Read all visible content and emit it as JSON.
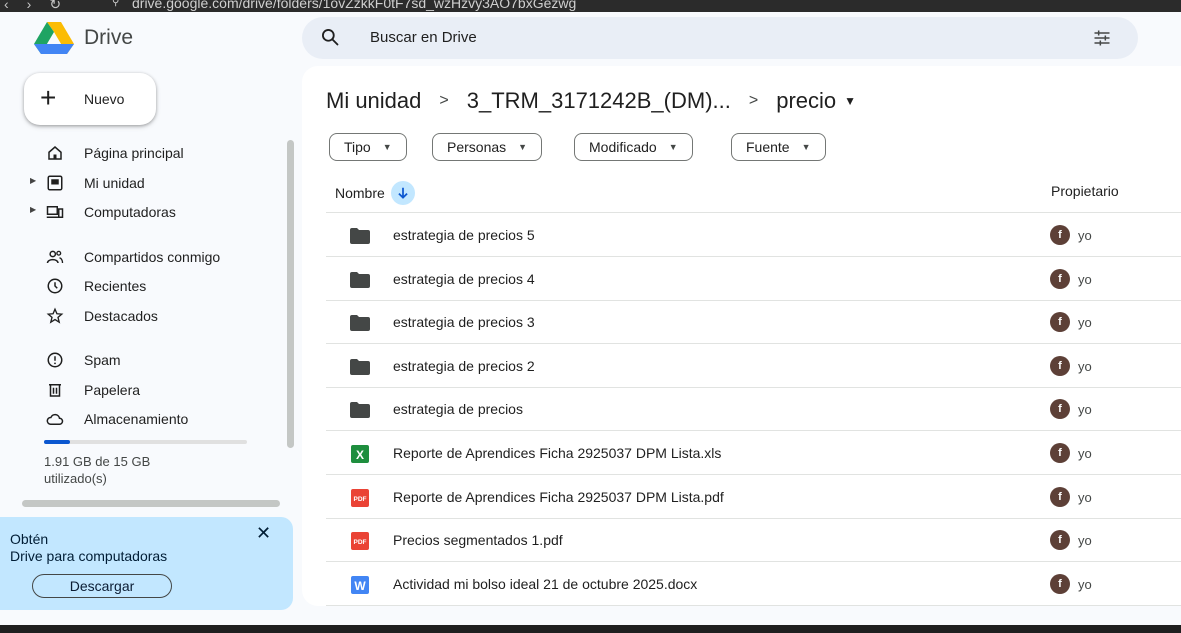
{
  "browser": {
    "url": "drive.google.com/drive/folders/1ovZzkkF0tF7sd_wzHzvy3AO7bxGezwg"
  },
  "header": {
    "brand": "Drive",
    "search_placeholder": "Buscar en Drive"
  },
  "sidebar": {
    "new_label": "Nuevo",
    "items": [
      {
        "label": "Página principal",
        "icon": "home-icon",
        "caret": false
      },
      {
        "label": "Mi unidad",
        "icon": "my-drive-icon",
        "caret": true
      },
      {
        "label": "Computadoras",
        "icon": "computers-icon",
        "caret": true
      },
      {
        "label": "Compartidos conmigo",
        "icon": "shared-icon",
        "caret": false
      },
      {
        "label": "Recientes",
        "icon": "clock-icon",
        "caret": false
      },
      {
        "label": "Destacados",
        "icon": "star-icon",
        "caret": false
      },
      {
        "label": "Spam",
        "icon": "spam-icon",
        "caret": false
      },
      {
        "label": "Papelera",
        "icon": "trash-icon",
        "caret": false
      },
      {
        "label": "Almacenamiento",
        "icon": "cloud-icon",
        "caret": false
      }
    ],
    "storage": {
      "text_line1": "1.91 GB de 15 GB",
      "text_line2": "utilizado(s)",
      "used_fraction": 0.127
    },
    "promo": {
      "line1": "Obtén",
      "line2": "Drive para computadoras",
      "button": "Descargar"
    }
  },
  "main": {
    "breadcrumb": [
      "Mi unidad",
      "3_TRM_3171242B_(DM)...",
      "precio"
    ],
    "filters": [
      "Tipo",
      "Personas",
      "Modificado",
      "Fuente"
    ],
    "columns": {
      "name": "Nombre",
      "owner": "Propietario"
    },
    "files": [
      {
        "name": "estrategia de precios 5",
        "type": "folder",
        "owner": "yo",
        "avatar": "f"
      },
      {
        "name": "estrategia de precios 4",
        "type": "folder",
        "owner": "yo",
        "avatar": "f"
      },
      {
        "name": "estrategia de precios 3",
        "type": "folder",
        "owner": "yo",
        "avatar": "f"
      },
      {
        "name": "estrategia de precios 2",
        "type": "folder",
        "owner": "yo",
        "avatar": "f"
      },
      {
        "name": "estrategia de precios",
        "type": "folder",
        "owner": "yo",
        "avatar": "f"
      },
      {
        "name": "Reporte de Aprendices Ficha 2925037 DPM Lista.xls",
        "type": "xls",
        "owner": "yo",
        "avatar": "f"
      },
      {
        "name": "Reporte de Aprendices Ficha 2925037 DPM Lista.pdf",
        "type": "pdf",
        "owner": "yo",
        "avatar": "f"
      },
      {
        "name": "Precios segmentados 1.pdf",
        "type": "pdf",
        "owner": "yo",
        "avatar": "f"
      },
      {
        "name": "Actividad mi bolso ideal 21 de octubre 2025.docx",
        "type": "docx",
        "owner": "yo",
        "avatar": "f"
      }
    ]
  },
  "colors": {
    "accent": "#0b57d0",
    "promo_bg": "#c2e7ff",
    "avatar_bg": "#5d4037"
  }
}
